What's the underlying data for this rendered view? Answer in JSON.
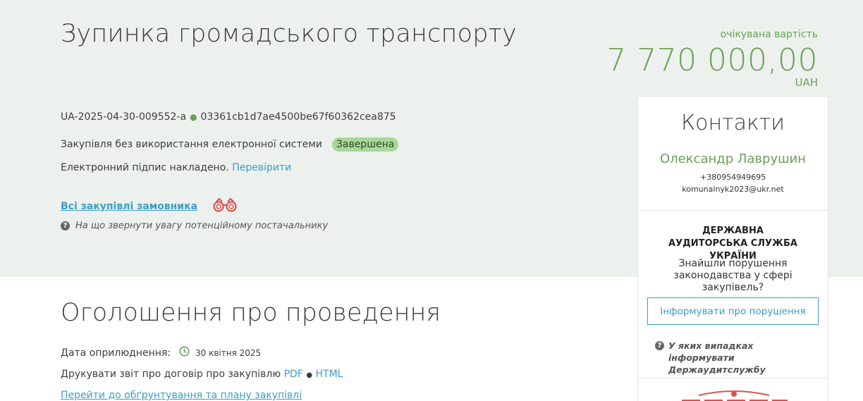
{
  "tender": {
    "title": "Зупинка громадського транспорту",
    "price_label": "очікувана вартість",
    "price": "7 770 000,00",
    "currency": "UAH",
    "id": "UA-2025-04-30-009552-a",
    "hash": "03361cb1d7ae4500be67f60362cea875",
    "method": "Закупівля без використання електронної системи",
    "status": "Завершена",
    "signature_text": "Електронний підпис накладено.",
    "signature_link": "Перевірити",
    "buyer_link": "Всі закупівлі замовника",
    "supplier_hint": "На що звернути увагу потенційному постачальнику"
  },
  "announcement": {
    "heading": "Оголошення про проведення",
    "pub_label": "Дата оприлюднення:",
    "pub_date": "30 квітня 2025",
    "report_text": "Друкувати звіт про договір про закупівлю",
    "pdf": "PDF",
    "separator": "●",
    "html": "HTML",
    "plan_link": "Перейти до обґрунтування та плану закупівлі"
  },
  "contacts": {
    "heading": "Контакти",
    "name": "Олександр Лаврушин",
    "phone": "+380954949695",
    "email": "komunalnyk2023@ukr.net",
    "dasu_title": "ДЕРЖАВНА АУДИТОРСЬКА СЛУЖБА УКРАЇНИ",
    "dasu_question": "Знайшли порушення законодавства у сфері закупівель?",
    "inform_button": "Інформувати про порушення",
    "inform_hint": "У яких випадках інформувати Держаудитслужбу"
  },
  "colors": {
    "accent_green": "#6aa158",
    "link_blue": "#3c9dc6",
    "hero_bg": "#ecf1ed",
    "badge_bg": "#a8d79a",
    "binoculars": "#d9534f"
  },
  "icons": {
    "binoculars": "binoculars-icon",
    "question": "question-circle-icon",
    "clock": "clock-icon"
  }
}
